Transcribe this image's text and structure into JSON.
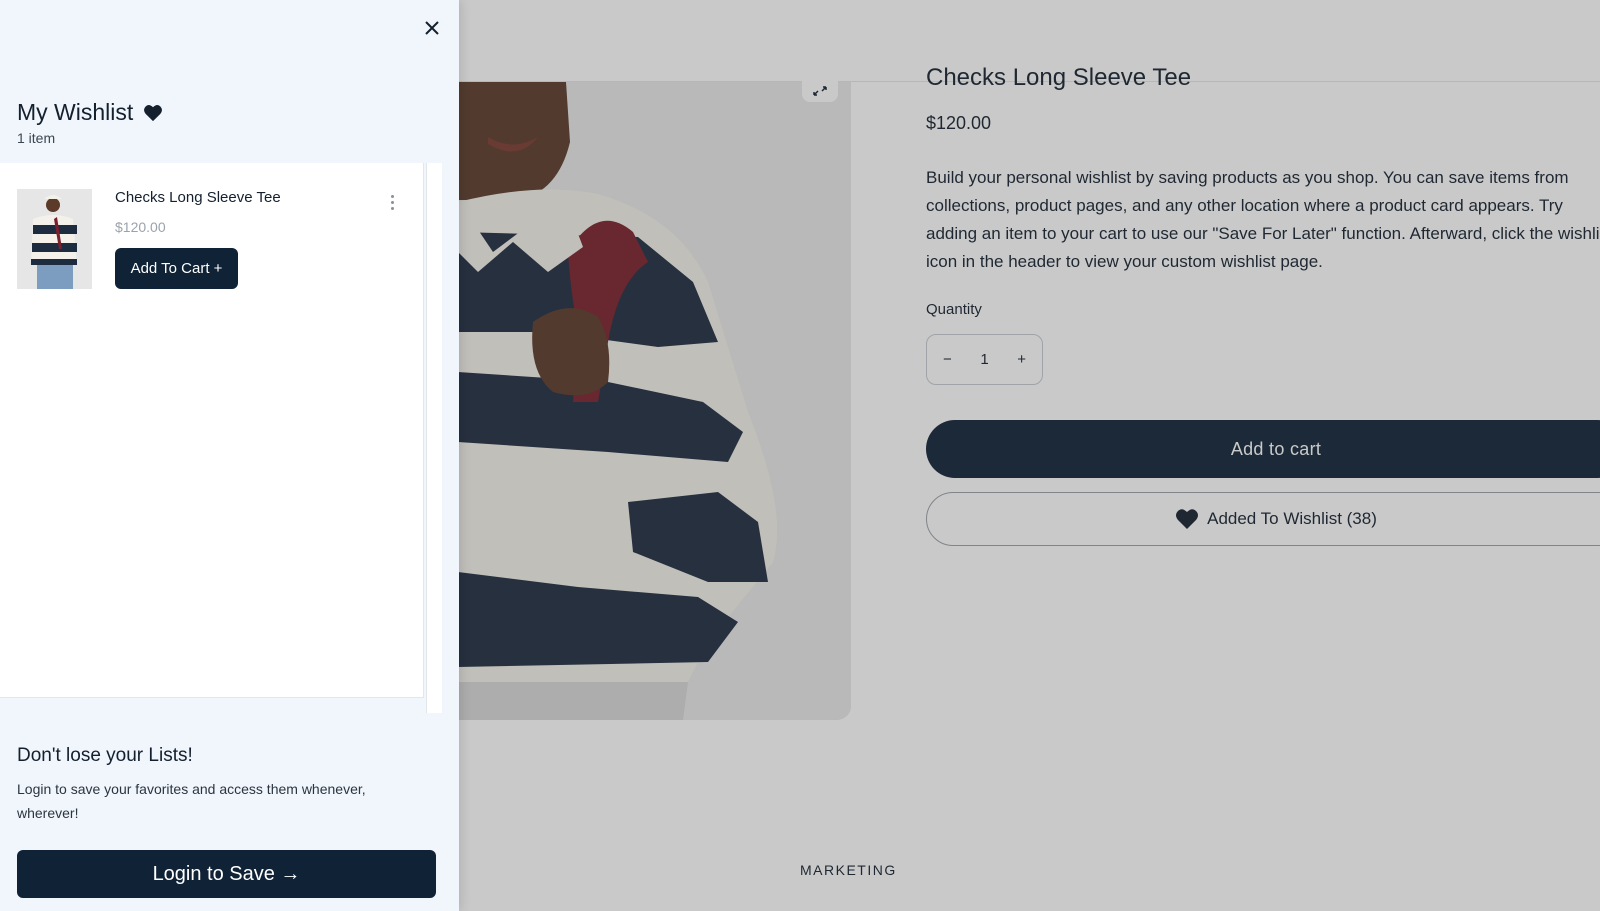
{
  "product": {
    "title": "Checks Long Sleeve Tee",
    "price": "$120.00",
    "description": "Build your personal wishlist by saving products as you shop. You can save items from collections, product pages, and any other location where a product card appears. Try adding an item to your cart to use our \"Save For Later\" function. Afterward, click the wishlist icon in the header to view your custom wishlist page.",
    "quantity_label": "Quantity",
    "quantity_value": "1",
    "quantity_minus": "−",
    "quantity_plus": "+",
    "add_to_cart_label": "Add to cart",
    "wishlist_button_label": "Added To Wishlist (38)",
    "zoom_icon": "expand-icon"
  },
  "footer": {
    "label": "MARKETING"
  },
  "drawer": {
    "close_icon": "close-icon",
    "title": "My Wishlist",
    "title_icon": "heart-icon",
    "count": "1 item",
    "items": [
      {
        "name": "Checks Long Sleeve Tee",
        "price": "$120.00",
        "add_to_cart_label": "Add To Cart +",
        "more_icon": "more-vertical-icon"
      }
    ],
    "promo": {
      "title": "Don't lose your Lists!",
      "text": "Login to save your favorites and access them whenever, wherever!",
      "login_label": "Login to Save →"
    }
  },
  "colors": {
    "primary": "#0f2236",
    "drawer_bg": "#f1f6fc",
    "muted_price": "#9aa3ad"
  }
}
